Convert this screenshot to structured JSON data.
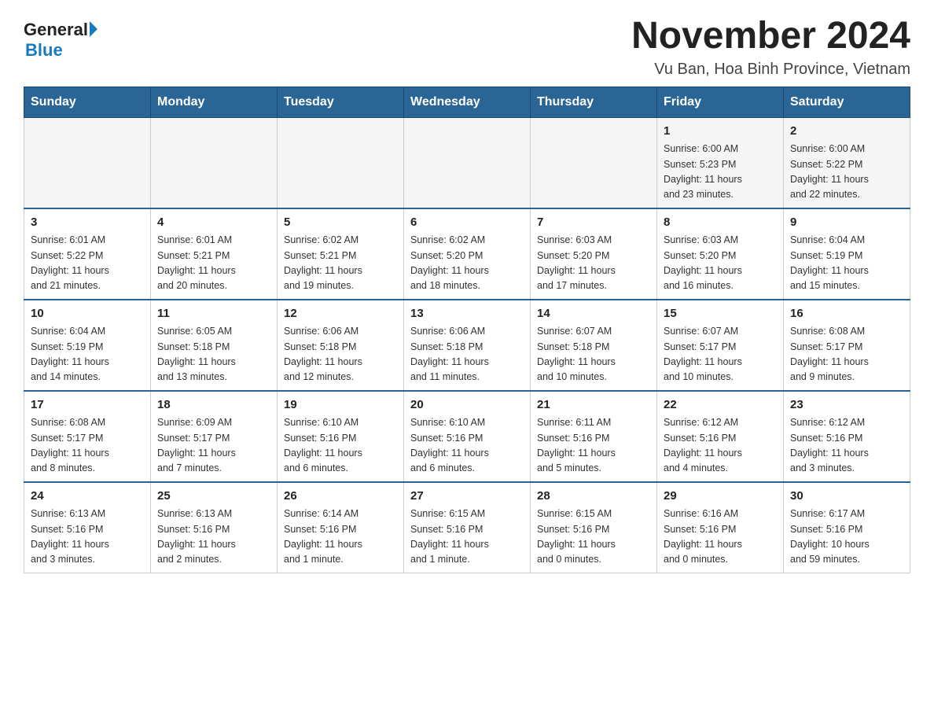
{
  "logo": {
    "general": "General",
    "blue": "Blue",
    "arrow": "▶"
  },
  "title": "November 2024",
  "subtitle": "Vu Ban, Hoa Binh Province, Vietnam",
  "weekdays": [
    "Sunday",
    "Monday",
    "Tuesday",
    "Wednesday",
    "Thursday",
    "Friday",
    "Saturday"
  ],
  "weeks": [
    [
      {
        "day": "",
        "info": ""
      },
      {
        "day": "",
        "info": ""
      },
      {
        "day": "",
        "info": ""
      },
      {
        "day": "",
        "info": ""
      },
      {
        "day": "",
        "info": ""
      },
      {
        "day": "1",
        "info": "Sunrise: 6:00 AM\nSunset: 5:23 PM\nDaylight: 11 hours\nand 23 minutes."
      },
      {
        "day": "2",
        "info": "Sunrise: 6:00 AM\nSunset: 5:22 PM\nDaylight: 11 hours\nand 22 minutes."
      }
    ],
    [
      {
        "day": "3",
        "info": "Sunrise: 6:01 AM\nSunset: 5:22 PM\nDaylight: 11 hours\nand 21 minutes."
      },
      {
        "day": "4",
        "info": "Sunrise: 6:01 AM\nSunset: 5:21 PM\nDaylight: 11 hours\nand 20 minutes."
      },
      {
        "day": "5",
        "info": "Sunrise: 6:02 AM\nSunset: 5:21 PM\nDaylight: 11 hours\nand 19 minutes."
      },
      {
        "day": "6",
        "info": "Sunrise: 6:02 AM\nSunset: 5:20 PM\nDaylight: 11 hours\nand 18 minutes."
      },
      {
        "day": "7",
        "info": "Sunrise: 6:03 AM\nSunset: 5:20 PM\nDaylight: 11 hours\nand 17 minutes."
      },
      {
        "day": "8",
        "info": "Sunrise: 6:03 AM\nSunset: 5:20 PM\nDaylight: 11 hours\nand 16 minutes."
      },
      {
        "day": "9",
        "info": "Sunrise: 6:04 AM\nSunset: 5:19 PM\nDaylight: 11 hours\nand 15 minutes."
      }
    ],
    [
      {
        "day": "10",
        "info": "Sunrise: 6:04 AM\nSunset: 5:19 PM\nDaylight: 11 hours\nand 14 minutes."
      },
      {
        "day": "11",
        "info": "Sunrise: 6:05 AM\nSunset: 5:18 PM\nDaylight: 11 hours\nand 13 minutes."
      },
      {
        "day": "12",
        "info": "Sunrise: 6:06 AM\nSunset: 5:18 PM\nDaylight: 11 hours\nand 12 minutes."
      },
      {
        "day": "13",
        "info": "Sunrise: 6:06 AM\nSunset: 5:18 PM\nDaylight: 11 hours\nand 11 minutes."
      },
      {
        "day": "14",
        "info": "Sunrise: 6:07 AM\nSunset: 5:18 PM\nDaylight: 11 hours\nand 10 minutes."
      },
      {
        "day": "15",
        "info": "Sunrise: 6:07 AM\nSunset: 5:17 PM\nDaylight: 11 hours\nand 10 minutes."
      },
      {
        "day": "16",
        "info": "Sunrise: 6:08 AM\nSunset: 5:17 PM\nDaylight: 11 hours\nand 9 minutes."
      }
    ],
    [
      {
        "day": "17",
        "info": "Sunrise: 6:08 AM\nSunset: 5:17 PM\nDaylight: 11 hours\nand 8 minutes."
      },
      {
        "day": "18",
        "info": "Sunrise: 6:09 AM\nSunset: 5:17 PM\nDaylight: 11 hours\nand 7 minutes."
      },
      {
        "day": "19",
        "info": "Sunrise: 6:10 AM\nSunset: 5:16 PM\nDaylight: 11 hours\nand 6 minutes."
      },
      {
        "day": "20",
        "info": "Sunrise: 6:10 AM\nSunset: 5:16 PM\nDaylight: 11 hours\nand 6 minutes."
      },
      {
        "day": "21",
        "info": "Sunrise: 6:11 AM\nSunset: 5:16 PM\nDaylight: 11 hours\nand 5 minutes."
      },
      {
        "day": "22",
        "info": "Sunrise: 6:12 AM\nSunset: 5:16 PM\nDaylight: 11 hours\nand 4 minutes."
      },
      {
        "day": "23",
        "info": "Sunrise: 6:12 AM\nSunset: 5:16 PM\nDaylight: 11 hours\nand 3 minutes."
      }
    ],
    [
      {
        "day": "24",
        "info": "Sunrise: 6:13 AM\nSunset: 5:16 PM\nDaylight: 11 hours\nand 3 minutes."
      },
      {
        "day": "25",
        "info": "Sunrise: 6:13 AM\nSunset: 5:16 PM\nDaylight: 11 hours\nand 2 minutes."
      },
      {
        "day": "26",
        "info": "Sunrise: 6:14 AM\nSunset: 5:16 PM\nDaylight: 11 hours\nand 1 minute."
      },
      {
        "day": "27",
        "info": "Sunrise: 6:15 AM\nSunset: 5:16 PM\nDaylight: 11 hours\nand 1 minute."
      },
      {
        "day": "28",
        "info": "Sunrise: 6:15 AM\nSunset: 5:16 PM\nDaylight: 11 hours\nand 0 minutes."
      },
      {
        "day": "29",
        "info": "Sunrise: 6:16 AM\nSunset: 5:16 PM\nDaylight: 11 hours\nand 0 minutes."
      },
      {
        "day": "30",
        "info": "Sunrise: 6:17 AM\nSunset: 5:16 PM\nDaylight: 10 hours\nand 59 minutes."
      }
    ]
  ]
}
